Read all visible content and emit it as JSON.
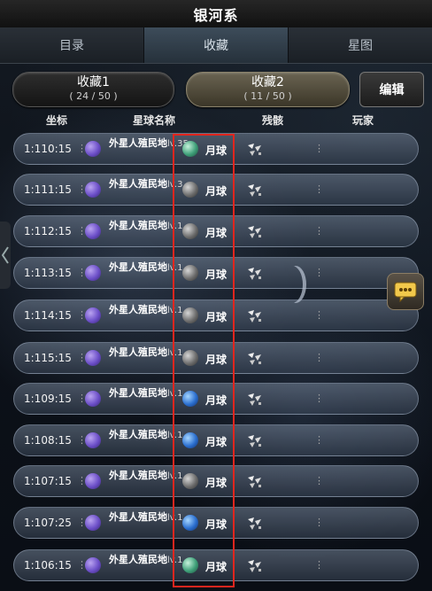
{
  "title": "银河系",
  "tabs": [
    {
      "label": "目录"
    },
    {
      "label": "收藏"
    },
    {
      "label": "星图"
    }
  ],
  "collections": [
    {
      "name": "收藏1",
      "count": "( 24 / 50 )"
    },
    {
      "name": "收藏2",
      "count": "( 11 / 50 )"
    }
  ],
  "edit_label": "编辑",
  "headers": {
    "coord": "坐标",
    "planet": "星球名称",
    "debris": "残骸",
    "player": "玩家"
  },
  "rows": [
    {
      "coord": "1:110:15",
      "name": "外星人殖民地",
      "level": "lv.35",
      "planet": "月球",
      "planet_color": "green"
    },
    {
      "coord": "1:111:15",
      "name": "外星人殖民地",
      "level": "lv.3",
      "planet": "月球",
      "planet_color": "gray"
    },
    {
      "coord": "1:112:15",
      "name": "外星人殖民地",
      "level": "lv.1",
      "planet": "月球",
      "planet_color": "gray"
    },
    {
      "coord": "1:113:15",
      "name": "外星人殖民地",
      "level": "lv.1",
      "planet": "月球",
      "planet_color": "gray"
    },
    {
      "coord": "1:114:15",
      "name": "外星人殖民地",
      "level": "lv.1",
      "planet": "月球",
      "planet_color": "gray"
    },
    {
      "coord": "1:115:15",
      "name": "外星人殖民地",
      "level": "lv.1",
      "planet": "月球",
      "planet_color": "gray"
    },
    {
      "coord": "1:109:15",
      "name": "外星人殖民地",
      "level": "lv.1",
      "planet": "月球",
      "planet_color": "blue"
    },
    {
      "coord": "1:108:15",
      "name": "外星人殖民地",
      "level": "lv.1",
      "planet": "月球",
      "planet_color": "blue"
    },
    {
      "coord": "1:107:15",
      "name": "外星人殖民地",
      "level": "lv.1",
      "planet": "月球",
      "planet_color": "gray"
    },
    {
      "coord": "1:107:25",
      "name": "外星人殖民地",
      "level": "lv.1",
      "planet": "月球",
      "planet_color": "blue"
    },
    {
      "coord": "1:106:15",
      "name": "外星人殖民地",
      "level": "lv.1",
      "planet": "月球",
      "planet_color": "green"
    }
  ],
  "icons": {
    "alien": "alien-planet-icon",
    "debris": "debris-icon",
    "chat": "chat-icon",
    "side": "chevron-left-icon"
  },
  "highlight_color": "#e0261e"
}
